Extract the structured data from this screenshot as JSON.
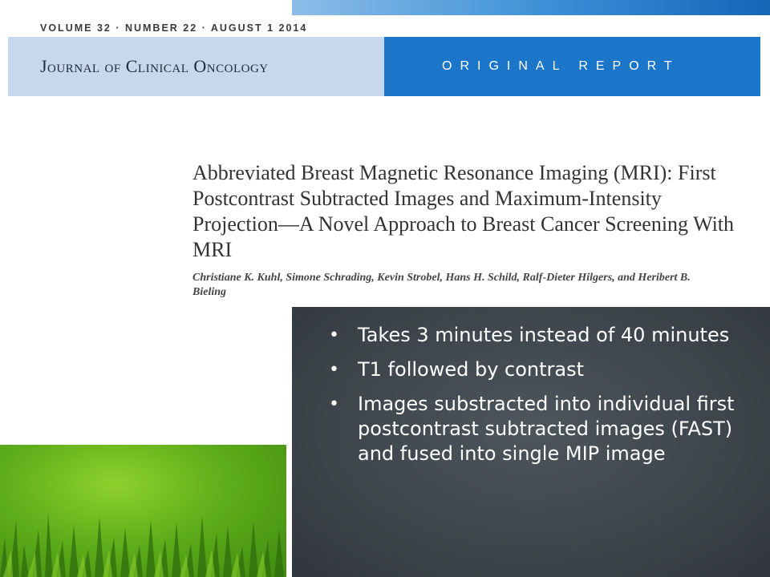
{
  "header": {
    "volume_line": "VOLUME 32 · NUMBER 22 · AUGUST 1 2014",
    "journal_name": "Journal of Clinical Oncology",
    "report_label": "ORIGINAL REPORT"
  },
  "article": {
    "title": "Abbreviated Breast Magnetic Resonance Imaging (MRI): First Postcontrast Subtracted Images and Maximum-Intensity Projection—A Novel Approach to Breast Cancer Screening With MRI",
    "authors": "Christiane K. Kuhl, Simone Schrading, Kevin Strobel, Hans H. Schild, Ralf-Dieter Hilgers, and Heribert B. Bieling"
  },
  "bullets": [
    "Takes 3 minutes instead of 40 minutes",
    "T1 followed by contrast",
    "Images substracted into individual first postcontrast subtracted images (FAST) and fused into single MIP image"
  ],
  "colors": {
    "header_blue": "#1b75c9",
    "header_light_blue": "#c5d8ee",
    "chalkboard": "#3d444b",
    "grass": "#5fae1a"
  }
}
